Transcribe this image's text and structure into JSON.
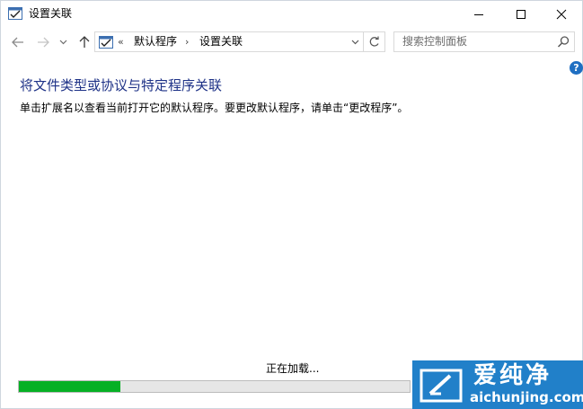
{
  "window": {
    "title": "设置关联"
  },
  "nav": {
    "back_icon": "arrow-left-icon",
    "forward_icon": "arrow-right-icon",
    "recent_icon": "chevron-down-icon",
    "up_icon": "arrow-up-icon"
  },
  "address": {
    "overflow": "«",
    "breadcrumbs": [
      {
        "label": "默认程序"
      },
      {
        "label": "设置关联"
      }
    ],
    "separator": "›"
  },
  "search": {
    "placeholder": "搜索控制面板"
  },
  "help": {
    "label": "?"
  },
  "main": {
    "heading": "将文件类型或协议与特定程序关联",
    "description": "单击扩展名以查看当前打开它的默认程序。要更改默认程序，请单击“更改程序”。",
    "loading_text": "正在加载...",
    "progress": 0.26
  },
  "watermark": {
    "brand": "爱纯净",
    "url": "aichunjing.com"
  },
  "colors": {
    "heading": "#1e3287",
    "progress_fill": "#06b025",
    "watermark_bg": "#2180c9"
  }
}
